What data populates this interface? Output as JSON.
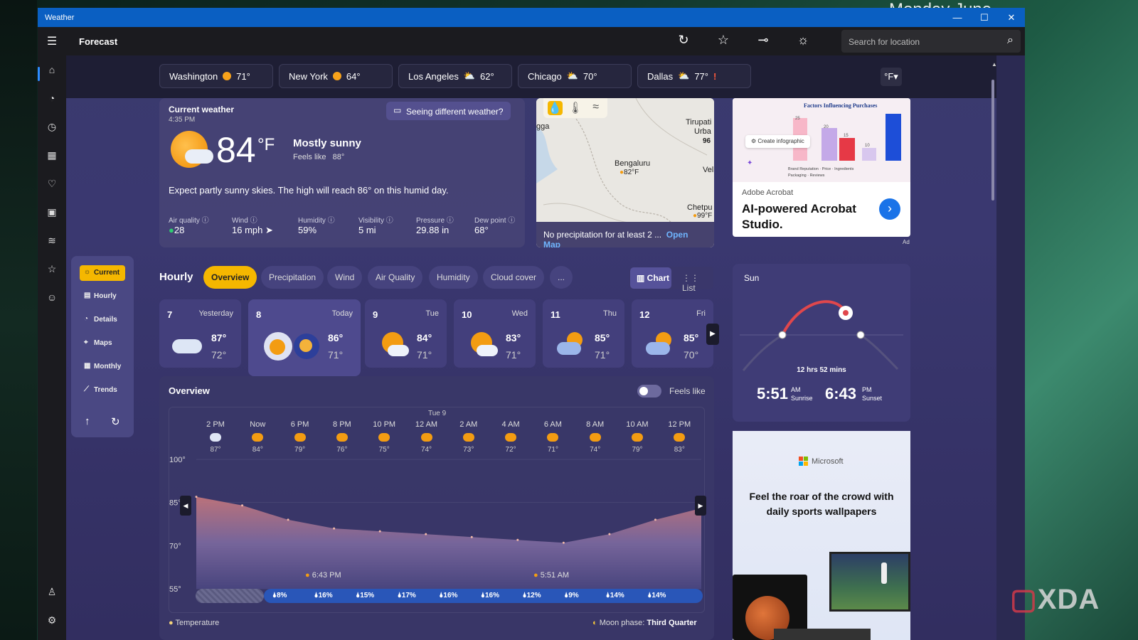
{
  "window": {
    "title": "Weather",
    "minimize": "—",
    "maximize": "☐",
    "close": "✕"
  },
  "appbar": {
    "title": "Forecast",
    "search_placeholder": "Search for location"
  },
  "cities": [
    {
      "name": "Washington",
      "temp": "71°"
    },
    {
      "name": "New York",
      "temp": "64°"
    },
    {
      "name": "Los Angeles",
      "temp": "62°"
    },
    {
      "name": "Chicago",
      "temp": "70°"
    },
    {
      "name": "Dallas",
      "temp": "77°",
      "alert": "!"
    }
  ],
  "unit": "°F",
  "current": {
    "heading": "Current weather",
    "time": "4:35 PM",
    "feedback": "Seeing different weather?",
    "temp": "84",
    "unit": "°F",
    "condition": "Mostly sunny",
    "feels_label": "Feels like",
    "feels": "88°",
    "summary": "Expect partly sunny skies. The high will reach 86° on this humid day.",
    "metrics": [
      {
        "label": "Air quality",
        "value": "28"
      },
      {
        "label": "Wind",
        "value": "16 mph"
      },
      {
        "label": "Humidity",
        "value": "59%"
      },
      {
        "label": "Visibility",
        "value": "5 mi"
      },
      {
        "label": "Pressure",
        "value": "29.88 in"
      },
      {
        "label": "Dew point",
        "value": "68°"
      }
    ]
  },
  "map": {
    "places": [
      {
        "name": "gga"
      },
      {
        "name": "Tirupati"
      },
      {
        "name": "Urba"
      },
      {
        "name": "96"
      },
      {
        "name": "Bengaluru"
      },
      {
        "name": "82°F"
      },
      {
        "name": "Vel"
      },
      {
        "name": "Chetpu"
      },
      {
        "name": "99°F"
      }
    ],
    "caption": "No precipitation for at least 2 ...",
    "open_map": "Open Map"
  },
  "ad1": {
    "chart_title": "Factors Influencing Purchases",
    "create_btn": "Create infographic",
    "legend": [
      "Brand Reputation",
      "Price",
      "Ingredients",
      "Packaging",
      "Reviews"
    ],
    "bar_labels": [
      "25",
      "20",
      "15",
      "10"
    ],
    "brand": "Adobe Acrobat",
    "headline": "AI-powered Acrobat Studio.",
    "ad_tag": "Ad",
    "colors": {
      "pink": "#f7b7c8",
      "purple": "#c4a9e8",
      "red": "#e63946",
      "lavender": "#d8c7ee",
      "blue": "#1d4ed8"
    }
  },
  "sidenav": [
    {
      "label": "Current"
    },
    {
      "label": "Hourly"
    },
    {
      "label": "Details"
    },
    {
      "label": "Maps"
    },
    {
      "label": "Monthly"
    },
    {
      "label": "Trends"
    }
  ],
  "hourly": {
    "heading": "Hourly",
    "tabs": [
      "Overview",
      "Precipitation",
      "Wind",
      "Air Quality",
      "Humidity",
      "Cloud cover",
      "..."
    ],
    "chart_btn": "Chart",
    "list_btn": "List"
  },
  "days": [
    {
      "num": "7",
      "label": "Yesterday",
      "hi": "87°",
      "lo": "72°"
    },
    {
      "num": "8",
      "label": "Today",
      "hi": "86°",
      "lo": "71°"
    },
    {
      "num": "9",
      "label": "Tue",
      "hi": "84°",
      "lo": "71°"
    },
    {
      "num": "10",
      "label": "Wed",
      "hi": "83°",
      "lo": "71°"
    },
    {
      "num": "11",
      "label": "Thu",
      "hi": "85°",
      "lo": "71°"
    },
    {
      "num": "12",
      "label": "Fri",
      "hi": "85°",
      "lo": "70°"
    }
  ],
  "overview": {
    "heading": "Overview",
    "feels_toggle": "Feels like",
    "date_marker": "Tue 9",
    "hours": [
      {
        "t": "2 PM",
        "v": "87°"
      },
      {
        "t": "Now",
        "v": "84°"
      },
      {
        "t": "6 PM",
        "v": "79°"
      },
      {
        "t": "8 PM",
        "v": "76°"
      },
      {
        "t": "10 PM",
        "v": "75°"
      },
      {
        "t": "12 AM",
        "v": "74°"
      },
      {
        "t": "2 AM",
        "v": "73°"
      },
      {
        "t": "4 AM",
        "v": "72°"
      },
      {
        "t": "6 AM",
        "v": "71°"
      },
      {
        "t": "8 AM",
        "v": "74°"
      },
      {
        "t": "10 AM",
        "v": "79°"
      },
      {
        "t": "12 PM",
        "v": "83°"
      }
    ],
    "y_ticks": [
      "100°",
      "85°",
      "70°",
      "55°"
    ],
    "sunset_marker": "6:43 PM",
    "sunrise_marker": "5:51 AM",
    "precip": [
      "8%",
      "16%",
      "15%",
      "17%",
      "16%",
      "16%",
      "12%",
      "9%",
      "14%",
      "14%"
    ],
    "legend_temp": "Temperature",
    "moon_label": "Moon phase:",
    "moon_value": "Third Quarter"
  },
  "sun": {
    "heading": "Sun",
    "duration": "12 hrs 52 mins",
    "sunrise_time": "5:51",
    "sunrise_ampm": "AM",
    "sunrise_label": "Sunrise",
    "sunset_time": "6:43",
    "sunset_ampm": "PM",
    "sunset_label": "Sunset"
  },
  "ad2": {
    "brand": "Microsoft",
    "headline": "Feel the roar of the crowd with daily sports wallpapers"
  },
  "overlay": {
    "monday": "Monday",
    "june": "June",
    "xda": "XDA"
  },
  "chart_data": {
    "type": "area",
    "x": [
      "2 PM",
      "Now",
      "6 PM",
      "8 PM",
      "10 PM",
      "12 AM",
      "2 AM",
      "4 AM",
      "6 AM",
      "8 AM",
      "10 AM",
      "12 PM"
    ],
    "series": [
      {
        "values": [
          87,
          84,
          79,
          76,
          75,
          74,
          73,
          72,
          71,
          74,
          79,
          83
        ]
      }
    ],
    "ylim": [
      55,
      100
    ],
    "yticks": [
      "100°",
      "85°",
      "70°",
      "55°"
    ],
    "title": "Overview"
  }
}
